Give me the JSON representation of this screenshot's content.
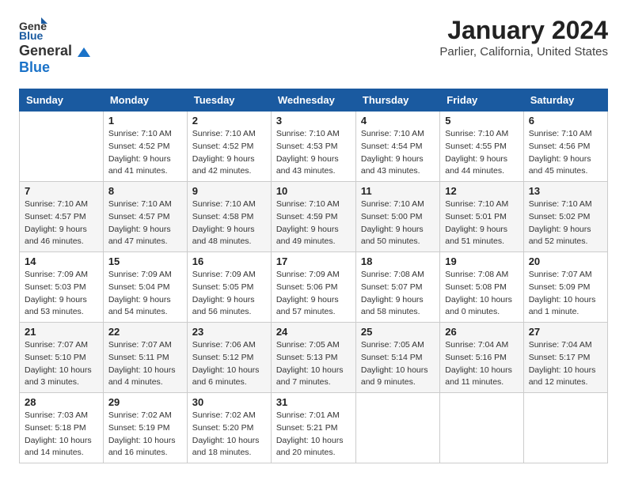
{
  "logo": {
    "line1": "General",
    "line2": "Blue"
  },
  "title": "January 2024",
  "subtitle": "Parlier, California, United States",
  "days_of_week": [
    "Sunday",
    "Monday",
    "Tuesday",
    "Wednesday",
    "Thursday",
    "Friday",
    "Saturday"
  ],
  "weeks": [
    [
      {
        "day": null
      },
      {
        "day": 1,
        "sunrise": "7:10 AM",
        "sunset": "4:52 PM",
        "daylight": "9 hours and 41 minutes."
      },
      {
        "day": 2,
        "sunrise": "7:10 AM",
        "sunset": "4:52 PM",
        "daylight": "9 hours and 42 minutes."
      },
      {
        "day": 3,
        "sunrise": "7:10 AM",
        "sunset": "4:53 PM",
        "daylight": "9 hours and 43 minutes."
      },
      {
        "day": 4,
        "sunrise": "7:10 AM",
        "sunset": "4:54 PM",
        "daylight": "9 hours and 43 minutes."
      },
      {
        "day": 5,
        "sunrise": "7:10 AM",
        "sunset": "4:55 PM",
        "daylight": "9 hours and 44 minutes."
      },
      {
        "day": 6,
        "sunrise": "7:10 AM",
        "sunset": "4:56 PM",
        "daylight": "9 hours and 45 minutes."
      }
    ],
    [
      {
        "day": 7,
        "sunrise": "7:10 AM",
        "sunset": "4:57 PM",
        "daylight": "9 hours and 46 minutes."
      },
      {
        "day": 8,
        "sunrise": "7:10 AM",
        "sunset": "4:57 PM",
        "daylight": "9 hours and 47 minutes."
      },
      {
        "day": 9,
        "sunrise": "7:10 AM",
        "sunset": "4:58 PM",
        "daylight": "9 hours and 48 minutes."
      },
      {
        "day": 10,
        "sunrise": "7:10 AM",
        "sunset": "4:59 PM",
        "daylight": "9 hours and 49 minutes."
      },
      {
        "day": 11,
        "sunrise": "7:10 AM",
        "sunset": "5:00 PM",
        "daylight": "9 hours and 50 minutes."
      },
      {
        "day": 12,
        "sunrise": "7:10 AM",
        "sunset": "5:01 PM",
        "daylight": "9 hours and 51 minutes."
      },
      {
        "day": 13,
        "sunrise": "7:10 AM",
        "sunset": "5:02 PM",
        "daylight": "9 hours and 52 minutes."
      }
    ],
    [
      {
        "day": 14,
        "sunrise": "7:09 AM",
        "sunset": "5:03 PM",
        "daylight": "9 hours and 53 minutes."
      },
      {
        "day": 15,
        "sunrise": "7:09 AM",
        "sunset": "5:04 PM",
        "daylight": "9 hours and 54 minutes."
      },
      {
        "day": 16,
        "sunrise": "7:09 AM",
        "sunset": "5:05 PM",
        "daylight": "9 hours and 56 minutes."
      },
      {
        "day": 17,
        "sunrise": "7:09 AM",
        "sunset": "5:06 PM",
        "daylight": "9 hours and 57 minutes."
      },
      {
        "day": 18,
        "sunrise": "7:08 AM",
        "sunset": "5:07 PM",
        "daylight": "9 hours and 58 minutes."
      },
      {
        "day": 19,
        "sunrise": "7:08 AM",
        "sunset": "5:08 PM",
        "daylight": "10 hours and 0 minutes."
      },
      {
        "day": 20,
        "sunrise": "7:07 AM",
        "sunset": "5:09 PM",
        "daylight": "10 hours and 1 minute."
      }
    ],
    [
      {
        "day": 21,
        "sunrise": "7:07 AM",
        "sunset": "5:10 PM",
        "daylight": "10 hours and 3 minutes."
      },
      {
        "day": 22,
        "sunrise": "7:07 AM",
        "sunset": "5:11 PM",
        "daylight": "10 hours and 4 minutes."
      },
      {
        "day": 23,
        "sunrise": "7:06 AM",
        "sunset": "5:12 PM",
        "daylight": "10 hours and 6 minutes."
      },
      {
        "day": 24,
        "sunrise": "7:05 AM",
        "sunset": "5:13 PM",
        "daylight": "10 hours and 7 minutes."
      },
      {
        "day": 25,
        "sunrise": "7:05 AM",
        "sunset": "5:14 PM",
        "daylight": "10 hours and 9 minutes."
      },
      {
        "day": 26,
        "sunrise": "7:04 AM",
        "sunset": "5:16 PM",
        "daylight": "10 hours and 11 minutes."
      },
      {
        "day": 27,
        "sunrise": "7:04 AM",
        "sunset": "5:17 PM",
        "daylight": "10 hours and 12 minutes."
      }
    ],
    [
      {
        "day": 28,
        "sunrise": "7:03 AM",
        "sunset": "5:18 PM",
        "daylight": "10 hours and 14 minutes."
      },
      {
        "day": 29,
        "sunrise": "7:02 AM",
        "sunset": "5:19 PM",
        "daylight": "10 hours and 16 minutes."
      },
      {
        "day": 30,
        "sunrise": "7:02 AM",
        "sunset": "5:20 PM",
        "daylight": "10 hours and 18 minutes."
      },
      {
        "day": 31,
        "sunrise": "7:01 AM",
        "sunset": "5:21 PM",
        "daylight": "10 hours and 20 minutes."
      },
      {
        "day": null
      },
      {
        "day": null
      },
      {
        "day": null
      }
    ]
  ],
  "labels": {
    "sunrise": "Sunrise:",
    "sunset": "Sunset:",
    "daylight": "Daylight:"
  }
}
